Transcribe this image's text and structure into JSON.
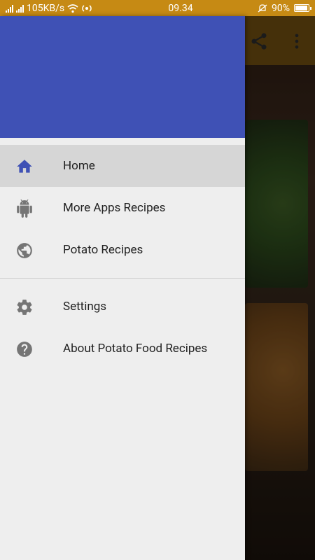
{
  "status_bar": {
    "speed": "105KB/s",
    "time": "09.34",
    "battery": "90%"
  },
  "colors": {
    "status_bar": "#c68a14",
    "drawer_header": "#3f51b5",
    "active_icon": "#3f51b5",
    "icon_gray": "#757575"
  },
  "drawer": {
    "primary_items": [
      {
        "label": "Home",
        "icon": "home-icon",
        "active": true
      },
      {
        "label": "More Apps Recipes",
        "icon": "android-icon",
        "active": false
      },
      {
        "label": "Potato Recipes",
        "icon": "globe-icon",
        "active": false
      }
    ],
    "secondary_items": [
      {
        "label": "Settings",
        "icon": "gear-icon"
      },
      {
        "label": "About Potato Food Recipes",
        "icon": "help-icon"
      }
    ]
  }
}
